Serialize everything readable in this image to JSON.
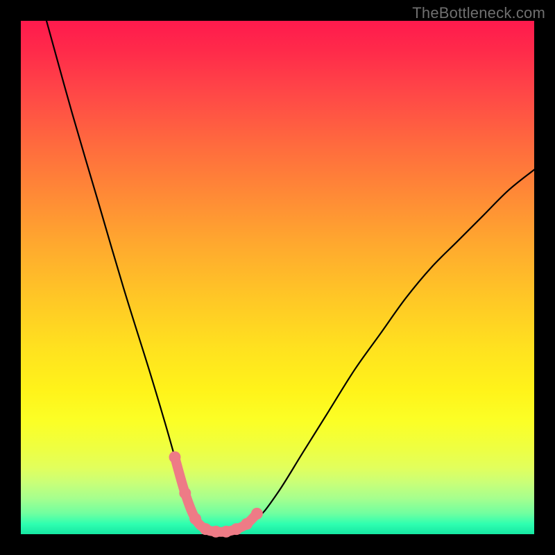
{
  "watermark": "TheBottleneck.com",
  "chart_data": {
    "type": "line",
    "title": "",
    "xlabel": "",
    "ylabel": "",
    "xlim": [
      0,
      100
    ],
    "ylim": [
      0,
      100
    ],
    "grid": false,
    "legend": false,
    "background_gradient": {
      "direction": "vertical",
      "stops": [
        {
          "pos": 0.0,
          "color": "#ff1a4d"
        },
        {
          "pos": 0.5,
          "color": "#ffd024"
        },
        {
          "pos": 0.85,
          "color": "#f3ff3a"
        },
        {
          "pos": 1.0,
          "color": "#16e7a3"
        }
      ]
    },
    "series": [
      {
        "name": "bottleneck-curve",
        "color": "#000000",
        "x": [
          5,
          10,
          15,
          20,
          25,
          28,
          30,
          32,
          34,
          36,
          38,
          40,
          42,
          46,
          50,
          55,
          60,
          65,
          70,
          75,
          80,
          85,
          90,
          95,
          100
        ],
        "y": [
          100,
          82,
          65,
          48,
          32,
          22,
          15,
          8,
          3,
          1,
          0.5,
          0.5,
          1,
          3,
          8,
          16,
          24,
          32,
          39,
          46,
          52,
          57,
          62,
          67,
          71
        ]
      }
    ],
    "highlight_range": {
      "name": "optimal-zone",
      "color": "#ee7b86",
      "x": [
        30,
        32,
        34,
        36,
        38,
        40,
        42,
        44,
        46
      ],
      "y": [
        15,
        8,
        3,
        1,
        0.5,
        0.5,
        1,
        2,
        4
      ]
    }
  }
}
